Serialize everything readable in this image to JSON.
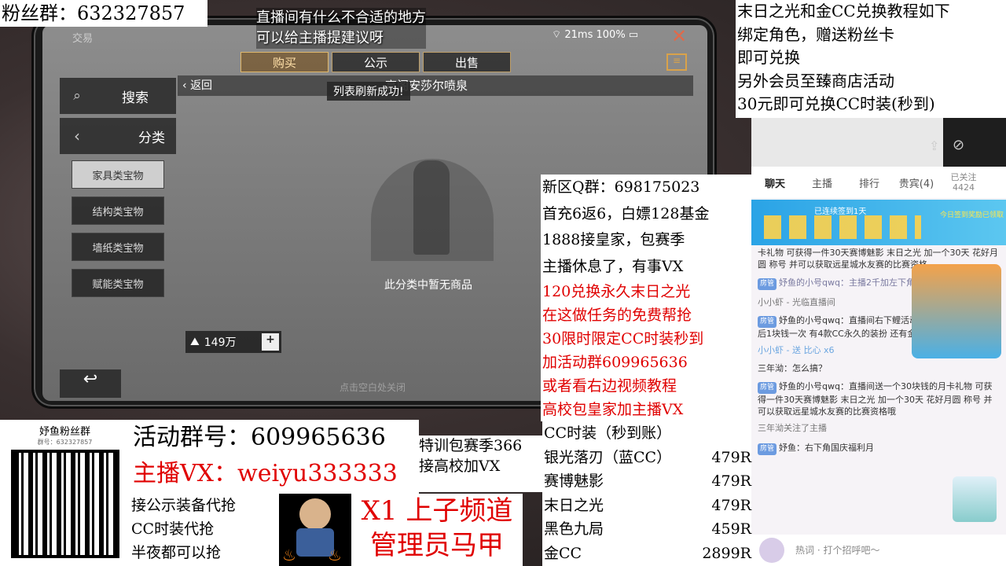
{
  "fan_group_top": "粉丝群：632327857",
  "stream_notice": [
    "直播间有什么不合适的地方",
    "可以给主播提建议呀"
  ],
  "game": {
    "header_label": "交易",
    "status": {
      "wifi": "21ms",
      "battery": "100%"
    },
    "tabs": [
      "购买",
      "公示",
      "出售"
    ],
    "search_label": "搜索",
    "category_label": "分类",
    "back_label": "返回",
    "location_title": "高阁安莎尔喷泉",
    "toast": "列表刷新成功!",
    "categories": [
      "家具类宝物",
      "结构类宝物",
      "墙纸类宝物",
      "赋能类宝物"
    ],
    "empty_text": "此分类中暂无商品",
    "currency": "149万",
    "bottom_hint": "点击空白处关闭"
  },
  "top_right_notice": [
    "末日之光和金CC兑换教程如下",
    "绑定角色，赠送粉丝卡",
    "即可兑换",
    "另外会员至臻商店活动",
    "30元即可兑换CC时装(秒到)"
  ],
  "mid_notice_black": [
    "新区Q群：698175023",
    "首充6返6，白嫖128基金",
    "1888接皇家，包赛季",
    "主播休息了，有事VX"
  ],
  "mid_notice_red": [
    "120兑换永久末日之光",
    "在这做任务的免费帮抢",
    "30限时限定CC时装秒到",
    "加活动群609965636",
    "或者看右边视频教程",
    "高校包皇家加主播VX"
  ],
  "price_list": {
    "title": "CC时装（秒到账）",
    "items": [
      {
        "name": "银光落刃（蓝CC）",
        "price": "479R"
      },
      {
        "name": "赛博魅影",
        "price": "479R"
      },
      {
        "name": "末日之光",
        "price": "479R"
      },
      {
        "name": "黑色九局",
        "price": "459R"
      },
      {
        "name": "金CC",
        "price": "2899R"
      }
    ]
  },
  "qr": {
    "title": "妤鱼粉丝群",
    "subtitle": "群号：632327857"
  },
  "activity_group": "活动群号：609965636",
  "anchor_vx": "主播VX：weiyu333333",
  "services": [
    "接公示装备代抢",
    "CC时装代抢",
    "半夜都可以抢"
  ],
  "training": [
    "特训包赛季366",
    "接高校加VX"
  ],
  "banner": [
    "X1 上子频道",
    "管理员马甲"
  ],
  "chat": {
    "tabs": [
      "聊天",
      "主播",
      "排行",
      "贵宾(4)",
      "已关注"
    ],
    "follow_count": "4424",
    "signin_banner": "已连续签到1天",
    "signin_right": "今日签到奖励已领取",
    "lines": [
      "卡礼物 可获得一件30天赛博魅影 末日之光 加一个30天 花好月圆 称号 并可以获取远星城水友赛的比赛资格",
      "妤鱼的小号qwq：主播2千加左下角vx或者进群",
      "小小虾 - 光临直播间",
      "妤鱼的小号qwq：直播间右下鲤活动 可以免费抽奖2次 之后1块钱一次 有4款CC永久的装扮 还有金CC噢",
      "小小虾 - 送 比心 x6",
      "三年泑：怎么搞？",
      "妤鱼的小号qwq：直播间送一个30块钱的月卡礼物 可获得一件30天赛博魅影 末日之光 加一个30天 花好月圆 称号 并可以获取远星城水友赛的比赛资格哦",
      "三年泑关注了主播",
      "妤鱼：右下角国庆福利月",
      "热词 · 打个招呼吧～"
    ]
  }
}
